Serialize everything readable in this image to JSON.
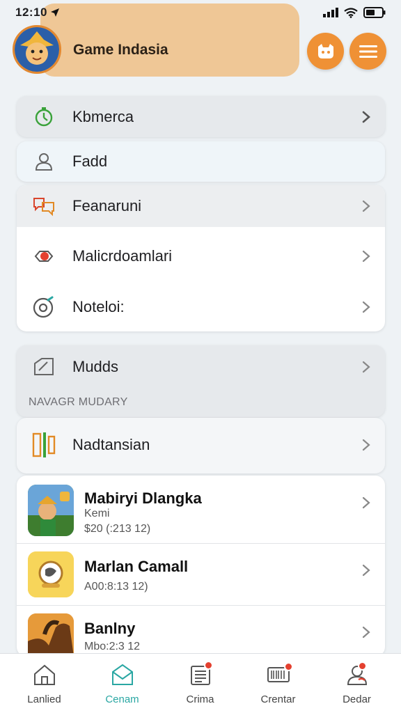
{
  "status_bar": {
    "time": "12:10"
  },
  "header": {
    "app_title": "Game Indasia"
  },
  "menu_group_1": [
    {
      "label": "Kbmerca",
      "icon": "stopwatch-icon"
    },
    {
      "label": "Fadd",
      "icon": "user-icon"
    }
  ],
  "menu_group_2": [
    {
      "label": "Feanaruni",
      "icon": "chat-bubbles-icon"
    },
    {
      "label": "Malicrdoamlari",
      "icon": "heart-chat-icon"
    },
    {
      "label": "Noteloi:",
      "icon": "disc-icon"
    }
  ],
  "menu_group_3": [
    {
      "label": "Mudds",
      "icon": "edit-icon"
    }
  ],
  "section_header": "NAVAGR MUDARY",
  "featured_item": {
    "label": "Nadtansian",
    "icon": "bars-icon"
  },
  "games": [
    {
      "name": "Mabiryi Dlangka",
      "line1": "Kemi",
      "line2": "$20 (:213 12)"
    },
    {
      "name": "Marlan Camall",
      "line1": "A00:8:13 12)",
      "line2": ""
    },
    {
      "name": "Banlny",
      "line1": "Mbo:2:3 12",
      "line2": ""
    }
  ],
  "tabs": [
    {
      "label": "Lanlied",
      "icon": "home-icon",
      "active": false
    },
    {
      "label": "Cenam",
      "icon": "mail-icon",
      "active": true
    },
    {
      "label": "Crima",
      "icon": "news-icon",
      "active": false
    },
    {
      "label": "Crentar",
      "icon": "barcode-icon",
      "active": false
    },
    {
      "label": "Dedar",
      "icon": "profile-icon",
      "active": false
    }
  ],
  "colors": {
    "accent": "#ef9135",
    "header_bg": "#efc796",
    "active_tab": "#2aa7a3"
  }
}
